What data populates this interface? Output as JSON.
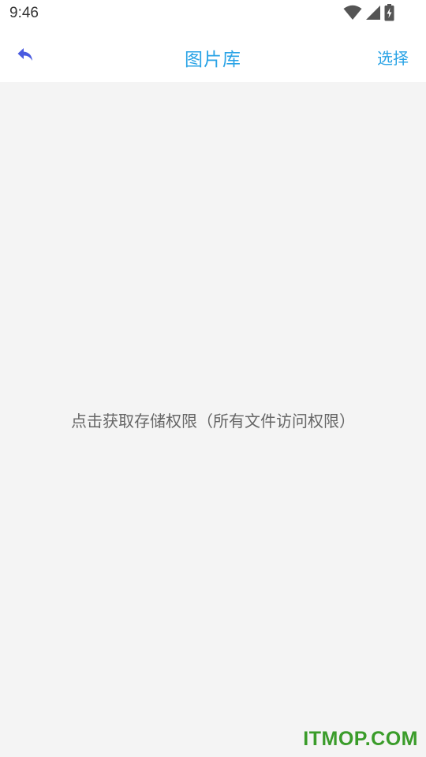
{
  "status_bar": {
    "time": "9:46",
    "icons": [
      "wifi-icon",
      "cellular-signal-icon",
      "battery-charging-icon"
    ]
  },
  "header": {
    "back_icon": "back-arrow-icon",
    "title": "图片库",
    "select_label": "选择"
  },
  "content": {
    "permission_prompt": "点击获取存储权限（所有文件访问权限）"
  },
  "watermark": {
    "text": "ITMOP.COM"
  },
  "colors": {
    "accent": "#29a3e6",
    "back_icon": "#4a5be0",
    "background": "#f4f4f4",
    "watermark": "#3a9c2a"
  }
}
